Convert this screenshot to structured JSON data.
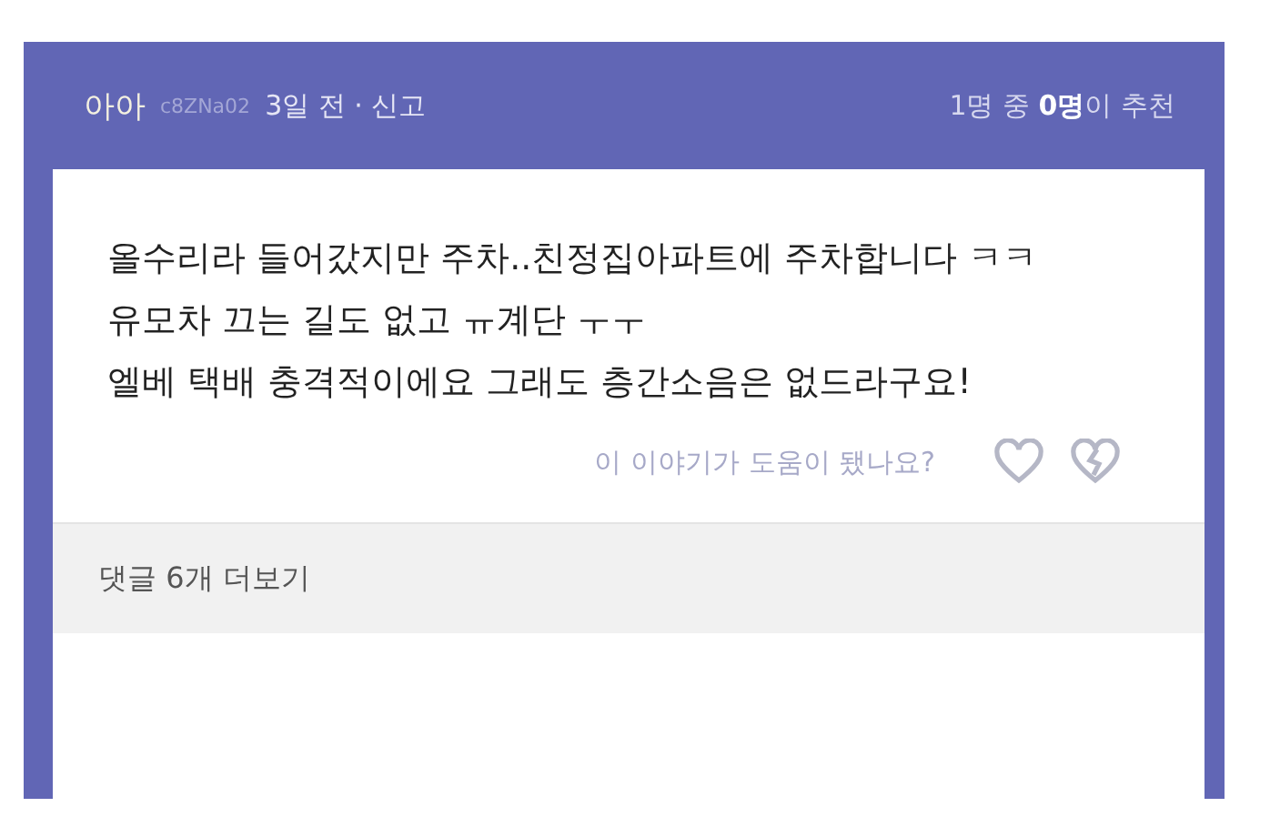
{
  "header": {
    "author": "아아",
    "user_id": "c8ZNa02",
    "meta": "3일 전 · 신고",
    "recommend": "1명 중 **0명**이 추천"
  },
  "post": {
    "lines": [
      "올수리라 들어갔지만 주차..친정집아파트에 주차합니다 ㅋㅋ",
      "유모차 끄는 길도 없고 ㅠ계단 ㅜㅜ",
      "엘베 택배 충격적이에요 그래도 층간소음은 없드라구요!"
    ]
  },
  "feedback": {
    "question": "이 이야기가 도움이 됐나요?"
  },
  "comments": {
    "label": "댓글 6개 더보기"
  }
}
